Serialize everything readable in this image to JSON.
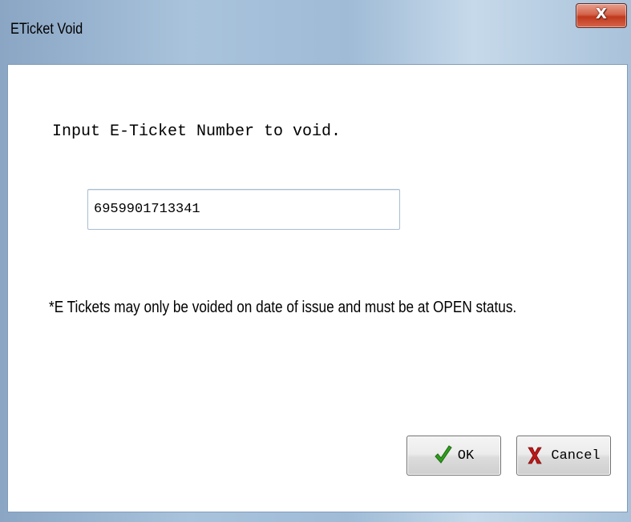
{
  "window": {
    "title": "ETicket Void",
    "close_glyph": "X"
  },
  "form": {
    "prompt": "Input E-Ticket Number to void.",
    "ticket_number": "6959901713341",
    "note": "*E Tickets may only be voided on date of issue and must be at OPEN status."
  },
  "buttons": {
    "ok_label": "OK",
    "ok_icon": "checkmark-icon",
    "cancel_label": "Cancel",
    "cancel_icon": "red-x-icon"
  },
  "colors": {
    "ok_icon": "#2f9e1e",
    "cancel_icon": "#c01818",
    "close_button": "#c8472c"
  }
}
